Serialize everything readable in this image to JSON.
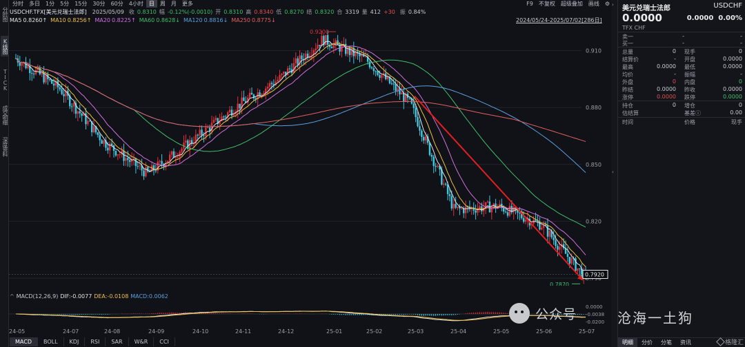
{
  "left_nav": [
    {
      "label": "分时图"
    },
    {
      "label": "K线图",
      "active": true
    },
    {
      "label": "TICK"
    },
    {
      "label": "成交明细"
    },
    {
      "label": "深度资料"
    }
  ],
  "toolbar": {
    "timeframes": [
      "分时",
      "多日",
      "1分",
      "5分",
      "15分",
      "30分",
      "60分",
      "4小时",
      "日",
      "周",
      "月",
      "更多"
    ],
    "active": "日",
    "right_items": [
      "F9",
      "不复权",
      "超级叠加",
      "画线",
      "⚙"
    ]
  },
  "quote": {
    "symbol": "USDCHF.TFX[美元兑瑞士法郎]",
    "date": "2025/05/09",
    "close_label": "收",
    "close": "0.8310",
    "chg_label": "幅",
    "chg": "-0.12%(-0.0010)",
    "open_label": "开",
    "open": "0.8310",
    "high_label": "高",
    "high": "0.8340",
    "low_label": "低",
    "low": "0.8270",
    "settle_label": "结",
    "settle": "0.8320",
    "amt_label": "合",
    "amt": "3319",
    "vol_label": "量",
    "vol": "412",
    "oi": "+30",
    "amp_label": "振",
    "amp": "0.84%"
  },
  "ma": [
    {
      "label": "MA5",
      "value": "0.8260↑",
      "color": "#e5e5e5"
    },
    {
      "label": "MA10",
      "value": "0.8256↑",
      "color": "#f0c14b"
    },
    {
      "label": "MA20",
      "value": "0.8225↑",
      "color": "#d070e0"
    },
    {
      "label": "MA60",
      "value": "0.8628↓",
      "color": "#3fbf6a"
    },
    {
      "label": "MA120",
      "value": "0.8816↓",
      "color": "#5aa0e0"
    },
    {
      "label": "MA250",
      "value": "0.8775↓",
      "color": "#e06060"
    }
  ],
  "date_range": "2024/05/24-2025/07/02[286日]",
  "chart_data": {
    "type": "candlestick",
    "yticks": [
      "0.910",
      "0.880",
      "0.850",
      "0.820",
      "0.790"
    ],
    "ylim": [
      0.786,
      0.924
    ],
    "xticks": [
      "24-05",
      "24-07",
      "24-08",
      "24-09",
      "24-10",
      "24-11",
      "24-12",
      "25-01",
      "25-02",
      "25-03",
      "25-04",
      "25-05",
      "25-06",
      "25-07"
    ],
    "high_label": "0.9200",
    "low_label": "0.7870",
    "last_price": "0.7920",
    "key_points": [
      {
        "x": "24-05",
        "y": 0.906
      },
      {
        "x": "24-07",
        "y": 0.89
      },
      {
        "x": "24-08",
        "y": 0.862
      },
      {
        "x": "24-09",
        "y": 0.845
      },
      {
        "x": "24-10",
        "y": 0.862
      },
      {
        "x": "24-11",
        "y": 0.88
      },
      {
        "x": "24-12",
        "y": 0.895
      },
      {
        "x": "25-01",
        "y": 0.916
      },
      {
        "x": "25-02",
        "y": 0.905
      },
      {
        "x": "25-03",
        "y": 0.882
      },
      {
        "x": "25-04",
        "y": 0.826
      },
      {
        "x": "25-05",
        "y": 0.828
      },
      {
        "x": "25-06",
        "y": 0.818
      },
      {
        "x": "25-07",
        "y": 0.79
      }
    ],
    "trendline_color": "#e02020"
  },
  "macd": {
    "label": "MACD(12,26,9)",
    "dif_label": "DIF:",
    "dif": "-0.0077",
    "dea_label": "DEA:",
    "dea": "-0.0108",
    "macd_label": "MACD:",
    "macd": "0.0062",
    "yticks": [
      "0.0000",
      "-0.0038",
      "-0.0200"
    ]
  },
  "bottom_tabs": [
    "MACD",
    "BOLL",
    "KDJ",
    "RSI",
    "SAR",
    "W&R",
    "CCI"
  ],
  "panel": {
    "title": "美元兑瑞士法郎",
    "code": "USDCHF",
    "price": "0.0000",
    "chg": "0.0000",
    "pct": "0.00%",
    "sub": "TFX  CHF",
    "orderbook": [
      {
        "label": "卖一",
        "v1": "-",
        "v2": "-"
      },
      {
        "label": "买一",
        "v1": "-",
        "v2": "-"
      }
    ],
    "stats": [
      {
        "l": "总量",
        "lv": "0",
        "r": "现手",
        "rv": "0"
      },
      {
        "l": "结算价",
        "lv": "-",
        "r": "开盘",
        "rv": "0.0000"
      },
      {
        "l": "最高",
        "lv": "0.0000",
        "r": "最低",
        "rv": "0.0000"
      },
      {
        "l": "均价",
        "lv": "-",
        "r": "振幅",
        "rv": "-"
      },
      {
        "l": "外盘",
        "lv": "0",
        "r": "内盘",
        "rv": "0"
      },
      {
        "l": "昨结",
        "lv": "0.0000",
        "r": "昨收",
        "rv": "0.0000"
      },
      {
        "l": "涨停",
        "lv": "0.0000",
        "r": "跌停",
        "rv": "0.0000"
      }
    ],
    "stats2": [
      {
        "l": "持仓",
        "lv": "0",
        "r": "增仓",
        "rv": "0"
      },
      {
        "l": "估结算",
        "lv": "",
        "r": "基差ⓘ",
        "rv": "0.00"
      }
    ],
    "trade_header": {
      "time": "时间",
      "price": "价格",
      "vol": "现手"
    },
    "tabs": [
      "明细",
      "分价",
      "分笔",
      "资讯"
    ],
    "brand": "格隆汇"
  },
  "watermark": {
    "text": "公众号",
    "text2": "沧海一土狗"
  }
}
